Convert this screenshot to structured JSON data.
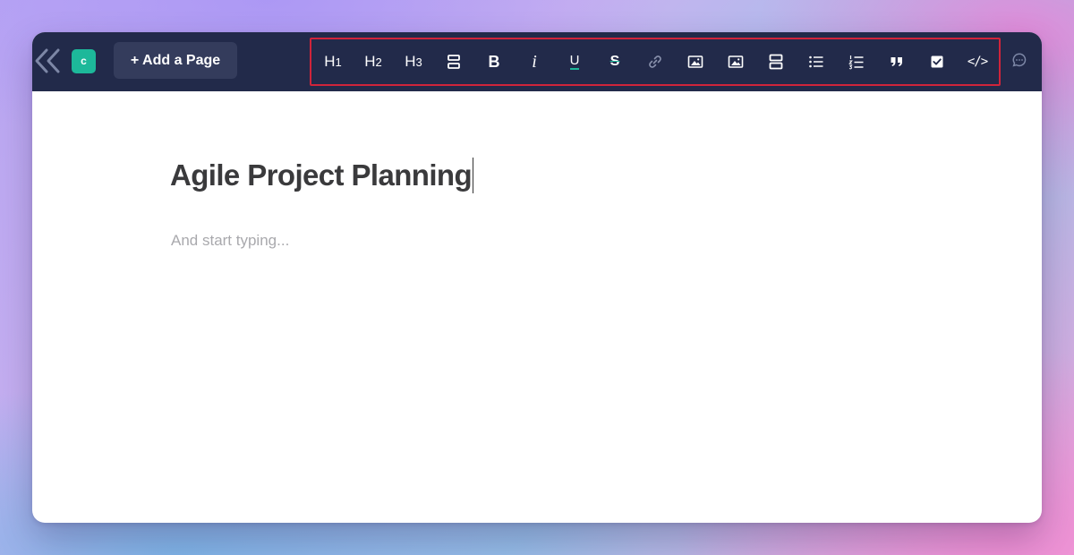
{
  "workspace": {
    "initial": "c"
  },
  "header": {
    "add_page_label": "+ Add a Page"
  },
  "toolbar": {
    "h1": {
      "main": "H",
      "sub": "1"
    },
    "h2": {
      "main": "H",
      "sub": "2"
    },
    "h3": {
      "main": "H",
      "sub": "3"
    },
    "bold": "B",
    "italic": "i",
    "underline": "U",
    "strike": "S",
    "quote": "”",
    "code": "</>"
  },
  "editor": {
    "title": "Agile Project Planning",
    "body_placeholder": "And start typing..."
  },
  "colors": {
    "topbar": "#222a4a",
    "accent": "#1db89a",
    "highlight_border": "#d0243a"
  }
}
